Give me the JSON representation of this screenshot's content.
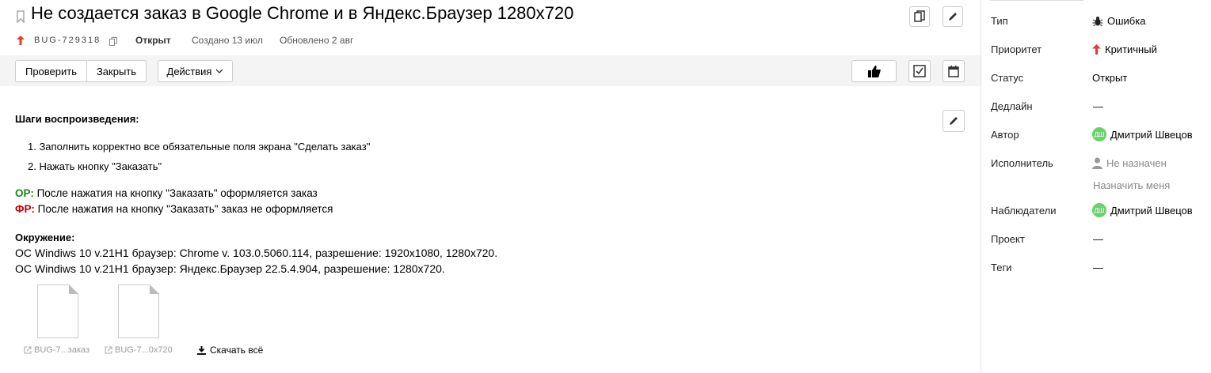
{
  "issue": {
    "title": "Не создается заказ в Google Chrome и в Яндекс.Браузер 1280x720",
    "key": "BUG-729318",
    "status": "Открыт",
    "created": "Создано 13 июл",
    "updated": "Обновлено 2 авг"
  },
  "toolbar": {
    "check_label": "Проверить",
    "close_label": "Закрыть",
    "actions_label": "Действия"
  },
  "description": {
    "steps_heading": "Шаги воспроизведения:",
    "steps": [
      "1. Заполнить корректно все обязательные поля экрана \"Сделать заказ\"",
      "2. Нажать кнопку \"Заказать\""
    ],
    "expected_label": "ОР:",
    "expected_text": " После нажатия на кнопку \"Заказать\" оформляется заказ",
    "actual_label": "ФР:",
    "actual_text": " После нажатия на кнопку \"Заказать\" заказ не оформляется",
    "env_heading": "Окружение:",
    "env_lines": [
      "ОС Windiws 10 v.21H1 браузер: Chrome v. 103.0.5060.114, разрешение: 1920x1080, 1280x720.",
      "ОС Windiws 10 v.21H1 браузер: Яндекс.Браузер 22.5.4.904, разрешение: 1280x720."
    ]
  },
  "attachments": {
    "files": [
      {
        "name": "BUG-7...заказ"
      },
      {
        "name": "BUG-7...0x720"
      }
    ],
    "download_all": "Скачать всё"
  },
  "sidebar": {
    "type_label": "Тип",
    "type_value": "Ошибка",
    "priority_label": "Приоритет",
    "priority_value": "Критичный",
    "status_label": "Статус",
    "status_value": "Открыт",
    "deadline_label": "Дедлайн",
    "deadline_value": "—",
    "author_label": "Автор",
    "author_initials": "ДШ",
    "author_name": "Дмитрий Швецов",
    "assignee_label": "Исполнитель",
    "assignee_value": "Не назначен",
    "assign_me": "Назначить меня",
    "watchers_label": "Наблюдатели",
    "watcher_initials": "ДШ",
    "watcher_name": "Дмитрий Швецов",
    "project_label": "Проект",
    "project_value": "—",
    "tags_label": "Теги",
    "tags_value": "—"
  },
  "colors": {
    "expected": "#1a8a1a",
    "actual": "#c00000",
    "priority_arrow": "#e53935",
    "avatar": "#6dd06d"
  }
}
